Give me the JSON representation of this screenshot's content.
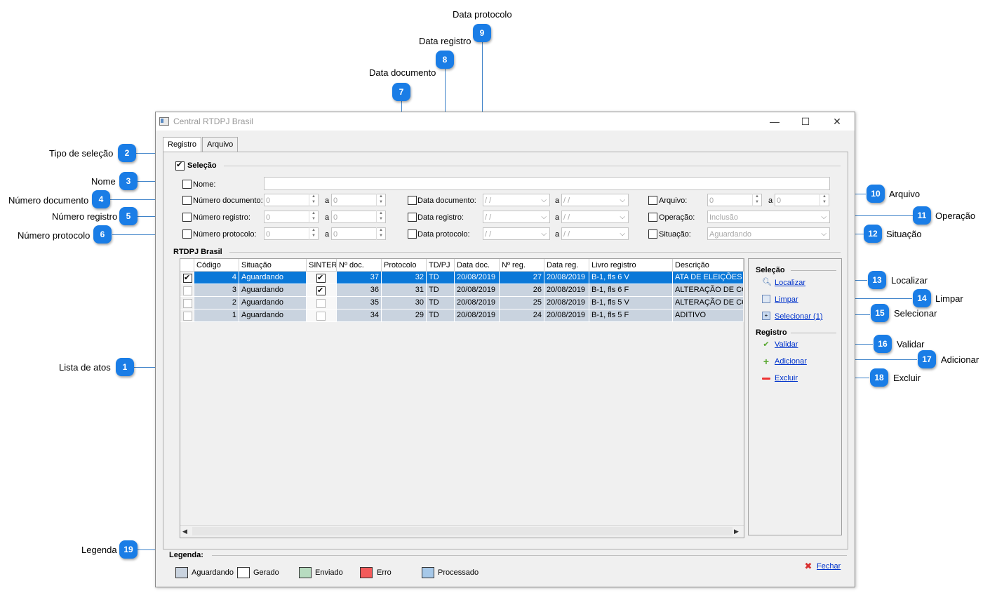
{
  "callouts": [
    {
      "n": "1",
      "label": "Lista de atos"
    },
    {
      "n": "2",
      "label": "Tipo de seleção"
    },
    {
      "n": "3",
      "label": "Nome"
    },
    {
      "n": "4",
      "label": "Número documento"
    },
    {
      "n": "5",
      "label": "Número registro"
    },
    {
      "n": "6",
      "label": "Número protocolo"
    },
    {
      "n": "7",
      "label": "Data documento"
    },
    {
      "n": "8",
      "label": "Data registro"
    },
    {
      "n": "9",
      "label": "Data protocolo"
    },
    {
      "n": "10",
      "label": "Arquivo"
    },
    {
      "n": "11",
      "label": "Operação"
    },
    {
      "n": "12",
      "label": "Situação"
    },
    {
      "n": "13",
      "label": "Localizar"
    },
    {
      "n": "14",
      "label": "Limpar"
    },
    {
      "n": "15",
      "label": "Selecionar"
    },
    {
      "n": "16",
      "label": "Validar"
    },
    {
      "n": "17",
      "label": "Adicionar"
    },
    {
      "n": "18",
      "label": "Excluir"
    },
    {
      "n": "19",
      "label": "Legenda"
    }
  ],
  "window": {
    "title": "Central RTDPJ Brasil",
    "minimize": "—",
    "maximize": "☐",
    "close": "✕"
  },
  "tabs": [
    "Registro",
    "Arquivo"
  ],
  "selecao": {
    "title": "Seleção",
    "nome_label": "Nome:",
    "num_doc_label": "Número documento:",
    "num_reg_label": "Número registro:",
    "num_prot_label": "Número protocolo:",
    "zero": "0",
    "a": "a",
    "data_doc_label": "Data documento:",
    "data_reg_label": "Data registro:",
    "data_prot_label": "Data protocolo:",
    "date_placeholder": " /  / ",
    "arquivo_label": "Arquivo:",
    "operacao_label": "Operação:",
    "operacao_value": "Inclusão",
    "situacao_label": "Situação:",
    "situacao_value": "Aguardando"
  },
  "grid": {
    "group_title": "RTDPJ Brasil",
    "headers": [
      "Código",
      "Situação",
      "SINTER",
      "Nº doc.",
      "Protocolo",
      "TD/PJ",
      "Data doc.",
      "Nº reg.",
      "Data reg.",
      "Livro registro",
      "Descrição"
    ],
    "rows": [
      {
        "codigo": "4",
        "situacao": "Aguardando",
        "sinter": true,
        "ndoc": "37",
        "protocolo": "32",
        "tdpj": "TD",
        "datadoc": "20/08/2019",
        "nreg": "27",
        "datareg": "20/08/2019",
        "livro": "B-1, fls 6 V",
        "descricao": "ATA DE ELEIÇÕES",
        "checked": true,
        "selected": true
      },
      {
        "codigo": "3",
        "situacao": "Aguardando",
        "sinter": true,
        "ndoc": "36",
        "protocolo": "31",
        "tdpj": "TD",
        "datadoc": "20/08/2019",
        "nreg": "26",
        "datareg": "20/08/2019",
        "livro": "B-1, fls 6 F",
        "descricao": "ALTERAÇÃO DE CON",
        "checked": false,
        "selected": false
      },
      {
        "codigo": "2",
        "situacao": "Aguardando",
        "sinter": false,
        "ndoc": "35",
        "protocolo": "30",
        "tdpj": "TD",
        "datadoc": "20/08/2019",
        "nreg": "25",
        "datareg": "20/08/2019",
        "livro": "B-1, fls 5 V",
        "descricao": "ALTERAÇÃO DE CON",
        "checked": false,
        "selected": false
      },
      {
        "codigo": "1",
        "situacao": "Aguardando",
        "sinter": false,
        "ndoc": "34",
        "protocolo": "29",
        "tdpj": "TD",
        "datadoc": "20/08/2019",
        "nreg": "24",
        "datareg": "20/08/2019",
        "livro": "B-1, fls 5 F",
        "descricao": "ADITIVO",
        "checked": false,
        "selected": false
      }
    ]
  },
  "side": {
    "selecao_title": "Seleção",
    "localizar": "Localizar",
    "limpar": "Limpar",
    "selecionar": "Selecionar (1)",
    "registro_title": "Registro",
    "validar": "Validar",
    "adicionar": "Adicionar",
    "excluir": "Excluir"
  },
  "legenda": {
    "title": "Legenda:",
    "items": [
      {
        "label": "Aguardando",
        "color": "#c9d3df"
      },
      {
        "label": "Gerado",
        "color": "#ffffff"
      },
      {
        "label": "Enviado",
        "color": "#b7dcc0"
      },
      {
        "label": "Erro",
        "color": "#f35a5a"
      },
      {
        "label": "Processado",
        "color": "#a6c8e8"
      }
    ],
    "fechar": "Fechar"
  },
  "colors": {
    "selected_row": "#0a78d8",
    "row_bg": "#c9d3df",
    "callout": "#1a7de6"
  }
}
